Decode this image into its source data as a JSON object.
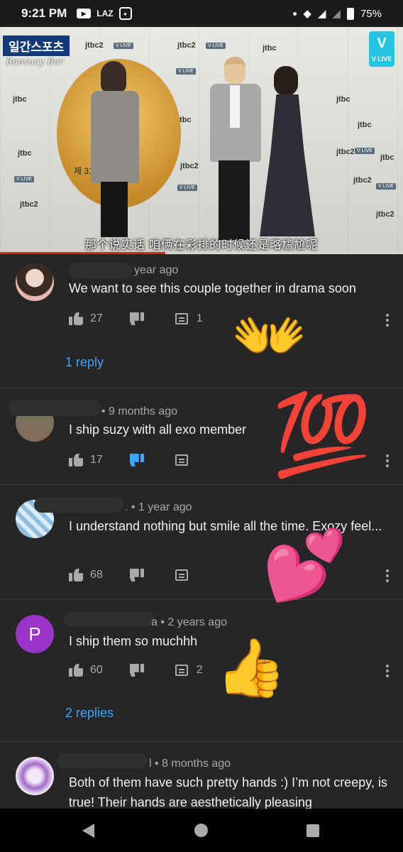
{
  "status_bar": {
    "time": "9:21 PM",
    "carrier_tag": "LAZ",
    "battery": "75%",
    "icons": [
      "youtube-icon",
      "notification-icon",
      "wifi-icon",
      "signal-icon",
      "battery-icon"
    ]
  },
  "video": {
    "brand_logo": "일간스포츠",
    "watermark": "Baesuzy Bar",
    "vlive_logo": "V",
    "vlive_label": "V LIVE",
    "award_text": "제 31회",
    "subtitle": "那个说实话  咱俩在彩排的时候还是略尴尬呢",
    "progress": 0.41
  },
  "comments": [
    {
      "meta": "year ago",
      "text": "We want to see this couple together in drama soon",
      "likes": "27",
      "reply_count": "1",
      "replies_link": "1 reply",
      "avatar": "photo"
    },
    {
      "meta": "• 9 months ago",
      "text": "I ship suzy with all exo member",
      "likes": "17",
      "reply_count": "",
      "replies_link": "",
      "avatar": "photo",
      "disliked": true
    },
    {
      "meta": ". • 1 year ago",
      "text": "I understand nothing but smile all the time. Exozy feel...",
      "likes": "68",
      "reply_count": "",
      "replies_link": "",
      "avatar": "photo"
    },
    {
      "meta": "a • 2 years ago",
      "text": "I ship them so muchhh",
      "likes": "60",
      "reply_count": "2",
      "replies_link": "2 replies",
      "avatar": "P"
    },
    {
      "meta": "l • 8 months ago",
      "text": "Both of them have such pretty hands :) I’m not creepy, is true! Their hands are aesthetically pleasing",
      "likes": "",
      "reply_count": "",
      "replies_link": "",
      "avatar": "photo"
    }
  ],
  "stickers": {
    "raising_hands": "👐",
    "hundred": "💯",
    "hearts": "💕",
    "thumbs_up": "👍"
  },
  "nav": {
    "icons": [
      "back-icon",
      "home-icon",
      "recents-icon"
    ]
  }
}
